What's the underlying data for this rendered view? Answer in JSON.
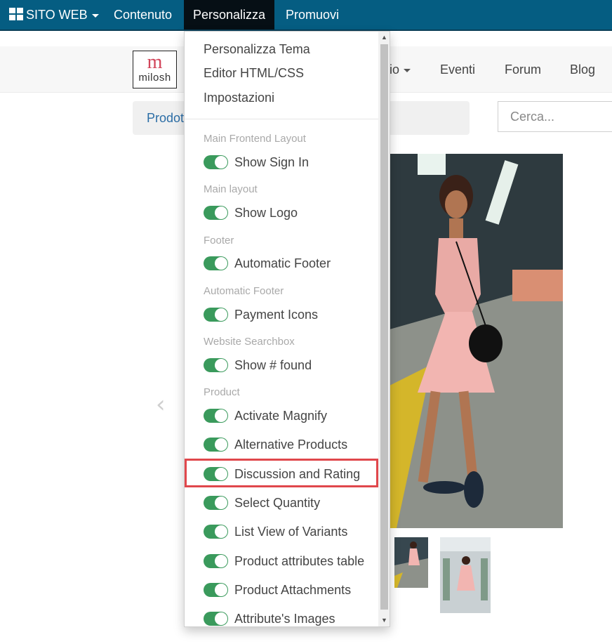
{
  "topbar": {
    "site_label": "SITO WEB",
    "content_label": "Contenuto",
    "customize_label": "Personalizza",
    "promote_label": "Promuovi"
  },
  "header": {
    "logo_letter": "m",
    "logo_text": "milosh",
    "nav_partial": "io",
    "nav_events": "Eventi",
    "nav_forum": "Forum",
    "nav_blog": "Blog"
  },
  "breadcrumb": {
    "text": "Prodot"
  },
  "search": {
    "placeholder": "Cerca..."
  },
  "dropdown": {
    "links": [
      "Personalizza Tema",
      "Editor HTML/CSS",
      "Impostazioni"
    ],
    "sections": {
      "main_frontend_layout": "Main Frontend Layout",
      "main_layout": "Main layout",
      "footer": "Footer",
      "automatic_footer": "Automatic Footer",
      "website_searchbox": "Website Searchbox",
      "product": "Product"
    },
    "toggles": {
      "show_sign_in": "Show Sign In",
      "show_logo": "Show Logo",
      "automatic_footer": "Automatic Footer",
      "payment_icons": "Payment Icons",
      "show_found": "Show # found",
      "activate_magnify": "Activate Magnify",
      "alternative_products": "Alternative Products",
      "discussion_rating": "Discussion and Rating",
      "select_quantity": "Select Quantity",
      "list_view_variants": "List View of Variants",
      "product_attributes_table": "Product attributes table",
      "product_attachments": "Product Attachments",
      "attribute_images": "Attribute's Images"
    },
    "toggle_state": "on"
  },
  "colors": {
    "topbar": "#055d82",
    "topbar_active": "#060f15",
    "toggle_on": "#3a9a5c",
    "highlight": "#e0474c"
  }
}
